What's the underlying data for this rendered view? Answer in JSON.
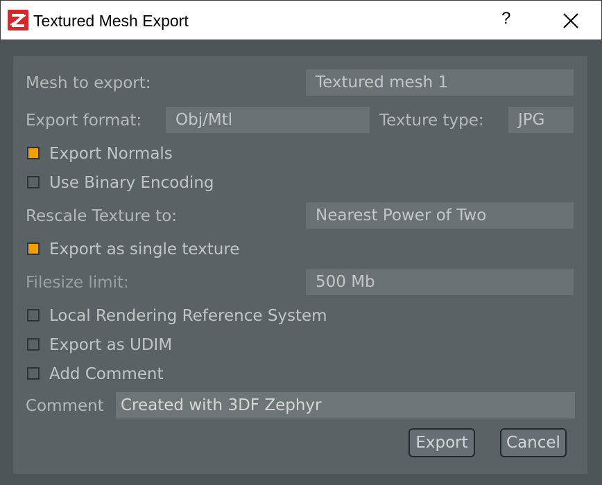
{
  "window": {
    "title": "Textured Mesh Export",
    "help_glyph": "?",
    "icons": {
      "app": "app-logo-icon",
      "close": "close-icon"
    }
  },
  "form": {
    "mesh_label": "Mesh to export:",
    "mesh_value": "Textured mesh 1",
    "format_label": "Export format:",
    "format_value": "Obj/Mtl",
    "texture_type_label": "Texture type:",
    "texture_type_value": "JPG",
    "export_normals": {
      "label": "Export Normals",
      "checked": true
    },
    "binary_encoding": {
      "label": "Use Binary Encoding",
      "checked": false
    },
    "rescale_label": "Rescale Texture to:",
    "rescale_value": "Nearest Power of Two",
    "single_texture": {
      "label": "Export as single texture",
      "checked": true
    },
    "filesize_label": "Filesize limit:",
    "filesize_value": "500 Mb",
    "local_rendering": {
      "label": "Local Rendering Reference System",
      "checked": false
    },
    "udim": {
      "label": "Export as UDIM",
      "checked": false
    },
    "add_comment": {
      "label": "Add Comment",
      "checked": false
    },
    "comment_label": "Comment",
    "comment_value": "Created with 3DF Zephyr"
  },
  "buttons": {
    "export": "Export",
    "cancel": "Cancel"
  },
  "colors": {
    "checkbox_checked": "#f0a000",
    "app_icon_red": "#d9262b"
  }
}
